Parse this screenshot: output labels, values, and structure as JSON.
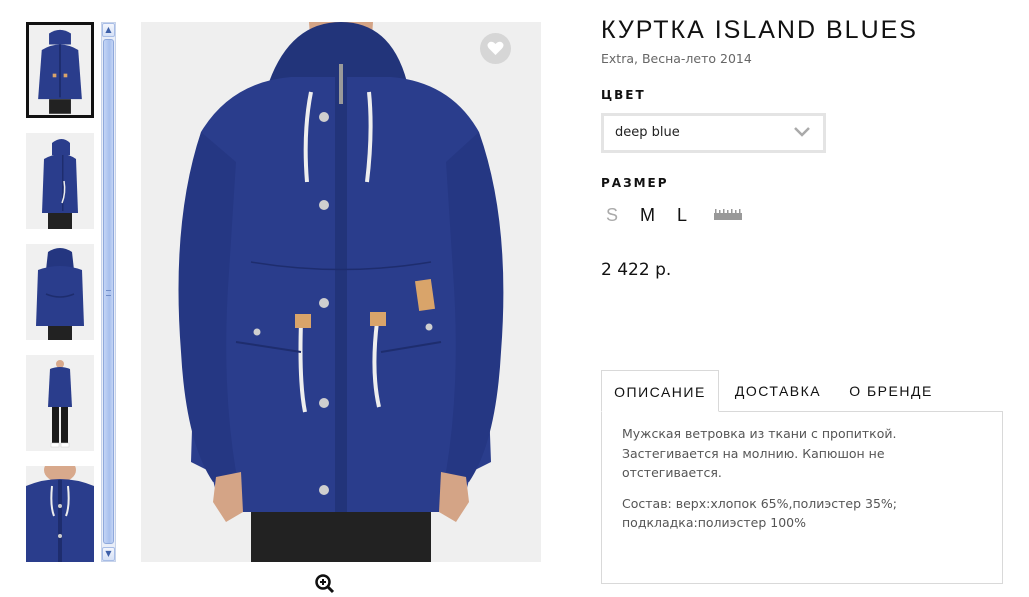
{
  "product": {
    "title": "КУРТКА ISLAND BLUES",
    "subtitle": "Extra, Весна-лето 2014",
    "color_label": "ЦВЕТ",
    "color_value": "deep blue",
    "size_label": "РАЗМЕР",
    "sizes": [
      "S",
      "M",
      "L"
    ],
    "size_available": [
      false,
      true,
      true
    ],
    "price": "2 422 р."
  },
  "tabs": [
    "ОПИСАНИЕ",
    "ДОСТАВКА",
    "О БРЕНДЕ"
  ],
  "active_tab": 0,
  "description": {
    "paragraph1": "Мужская ветровка из ткани с пропиткой. Застегивается на молнию. Капюшон не отстегивается.",
    "paragraph2": "Состав: верх:хлопок 65%,полиэстер 35%; подкладка:полиэстер 100%"
  },
  "gallery": {
    "thumbnail_count": 5,
    "active_thumbnail": 0,
    "views": [
      "front",
      "side",
      "back",
      "full-body",
      "detail"
    ]
  },
  "icons": [
    "heart-icon",
    "chevron-down-icon",
    "ruler-icon",
    "zoom-in-icon",
    "scroll-up-arrow-icon",
    "scroll-down-arrow-icon"
  ],
  "colors": {
    "jacket": "#2a3d8c",
    "jacket_shadow": "#1e2d6e",
    "background": "#efefef",
    "active_border": "#111111",
    "muted_text": "#666666"
  }
}
